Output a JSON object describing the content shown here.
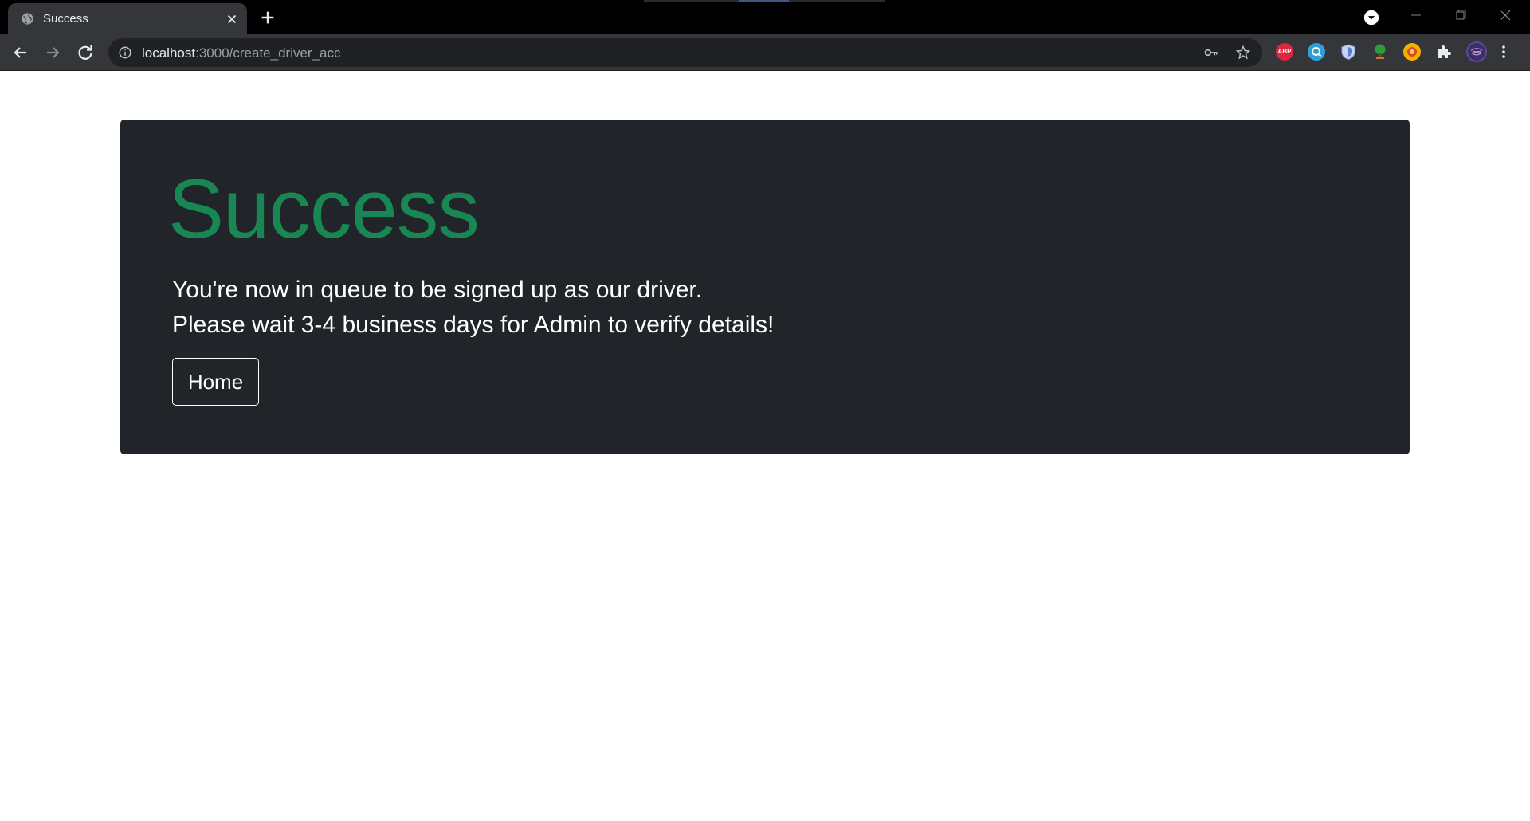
{
  "browser": {
    "tab": {
      "title": "Success"
    },
    "address_bar": {
      "host": "localhost",
      "path": ":3000/create_driver_acc"
    },
    "extensions": {
      "abp_label": "ABP"
    }
  },
  "page": {
    "heading": "Success",
    "message_lines": [
      "You're now in queue to be signed up as our driver.",
      "Please wait 3-4 business days for Admin to verify details!"
    ],
    "home_button_label": "Home",
    "colors": {
      "heading": "#198754",
      "panel_background": "#212529",
      "text": "#ffffff"
    }
  }
}
